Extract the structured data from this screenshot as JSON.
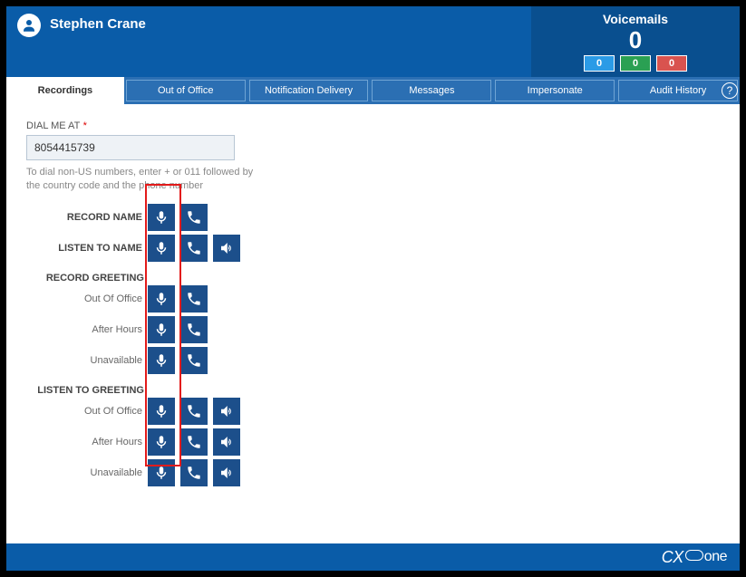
{
  "header": {
    "username": "Stephen Crane",
    "voicemails_label": "Voicemails",
    "voicemails_count": "0",
    "badges": {
      "blue": "0",
      "green": "0",
      "red": "0"
    }
  },
  "tabs": {
    "recordings": "Recordings",
    "out_of_office": "Out of Office",
    "notification_delivery": "Notification Delivery",
    "messages": "Messages",
    "impersonate": "Impersonate",
    "audit_history": "Audit History"
  },
  "help_label": "?",
  "form": {
    "dial_label": "DIAL ME AT",
    "required_mark": "*",
    "dial_value": "8054415739",
    "hint": "To dial non-US numbers, enter + or 011 followed by the country code and the phone number"
  },
  "sections": {
    "record_name": "RECORD NAME",
    "listen_name": "LISTEN TO NAME",
    "record_greeting_header": "RECORD GREETING",
    "listen_greeting_header": "LISTEN TO GREETING",
    "out_of_office": "Out Of Office",
    "after_hours": "After Hours",
    "unavailable": "Unavailable"
  },
  "footer": {
    "brand_cx": "CX",
    "brand_one": "one"
  }
}
